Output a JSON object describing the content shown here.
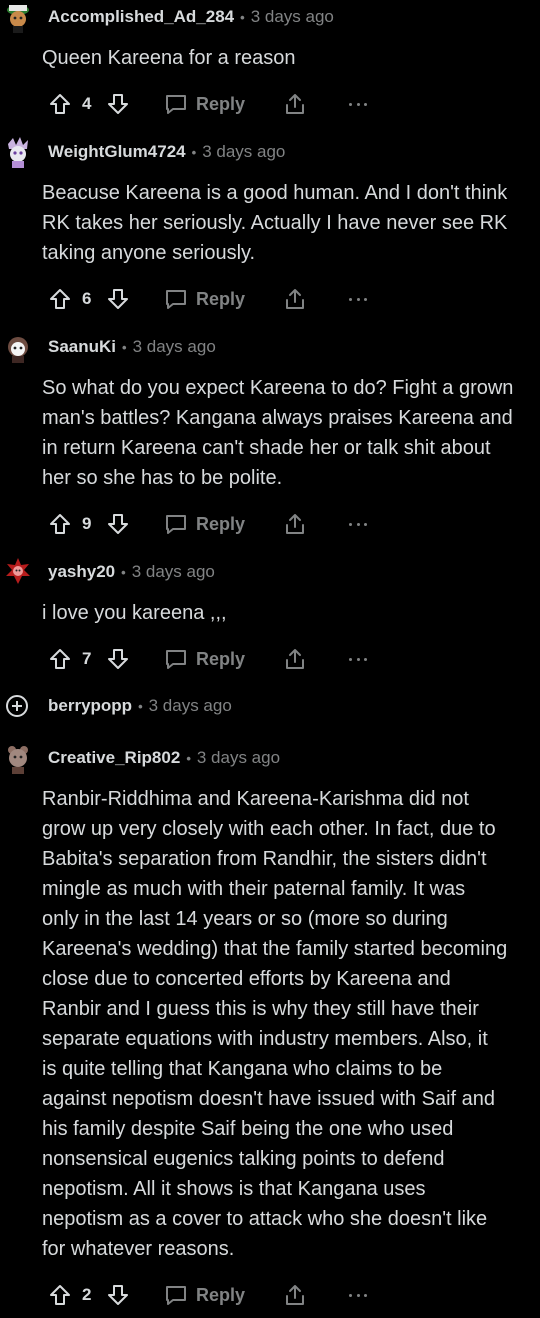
{
  "colors": {
    "background": "#000000",
    "text": "#d7dadc",
    "muted": "#818384"
  },
  "comments": [
    {
      "username": "Accomplished_Ad_284",
      "time": "3 days ago",
      "lines": [
        "Queen Kareena for a reason"
      ],
      "votes": "4",
      "reply_label": "Reply"
    },
    {
      "username": "WeightGlum4724",
      "time": "3 days ago",
      "lines": [
        "Beacuse Kareena is a good human. And I don't think",
        "RK takes her seriously. Actually I have never see RK",
        "taking anyone seriously."
      ],
      "votes": "6",
      "reply_label": "Reply"
    },
    {
      "username": "SaanuKi",
      "time": "3 days ago",
      "lines": [
        "So what do you expect Kareena to do? Fight a grown",
        "man's battles? Kangana always praises Kareena and",
        "in return Kareena can't shade her or talk shit about",
        "her so she has to be polite."
      ],
      "votes": "9",
      "reply_label": "Reply"
    },
    {
      "username": "yashy20",
      "time": "3 days ago",
      "lines": [
        "i love you kareena ,,,"
      ],
      "votes": "7",
      "reply_label": "Reply"
    },
    {
      "username": "berrypopp",
      "time": "3 days ago",
      "collapsed": true
    },
    {
      "username": "Creative_Rip802",
      "time": "3 days ago",
      "lines": [
        "Ranbir-Riddhima and Kareena-Karishma did not",
        "grow up very closely with each other. In fact, due to",
        "Babita's separation from Randhir, the sisters didn't",
        "mingle as much with their paternal family. It was",
        "only in the last 14 years or so (more so during",
        "Kareena's wedding) that the family started becoming",
        "close due to concerted efforts by Kareena and",
        "Ranbir and I guess this is why they still have their",
        "separate equations with industry members. Also, it",
        "is quite telling that Kangana who claims to be",
        "against nepotism doesn't have issued with Saif and",
        "his family despite Saif being the one who used",
        "nonsensical eugenics talking points to defend",
        "nepotism. All it shows is that Kangana uses",
        "nepotism as a cover to attack who she doesn't like",
        "for whatever reasons."
      ],
      "votes": "2",
      "reply_label": "Reply"
    }
  ],
  "icons": {
    "upvote": "arrow-up-icon",
    "downvote": "arrow-down-icon",
    "reply": "speech-bubble-icon",
    "share": "share-icon",
    "more": "more-dots-icon",
    "expand": "plus-circle-icon"
  }
}
